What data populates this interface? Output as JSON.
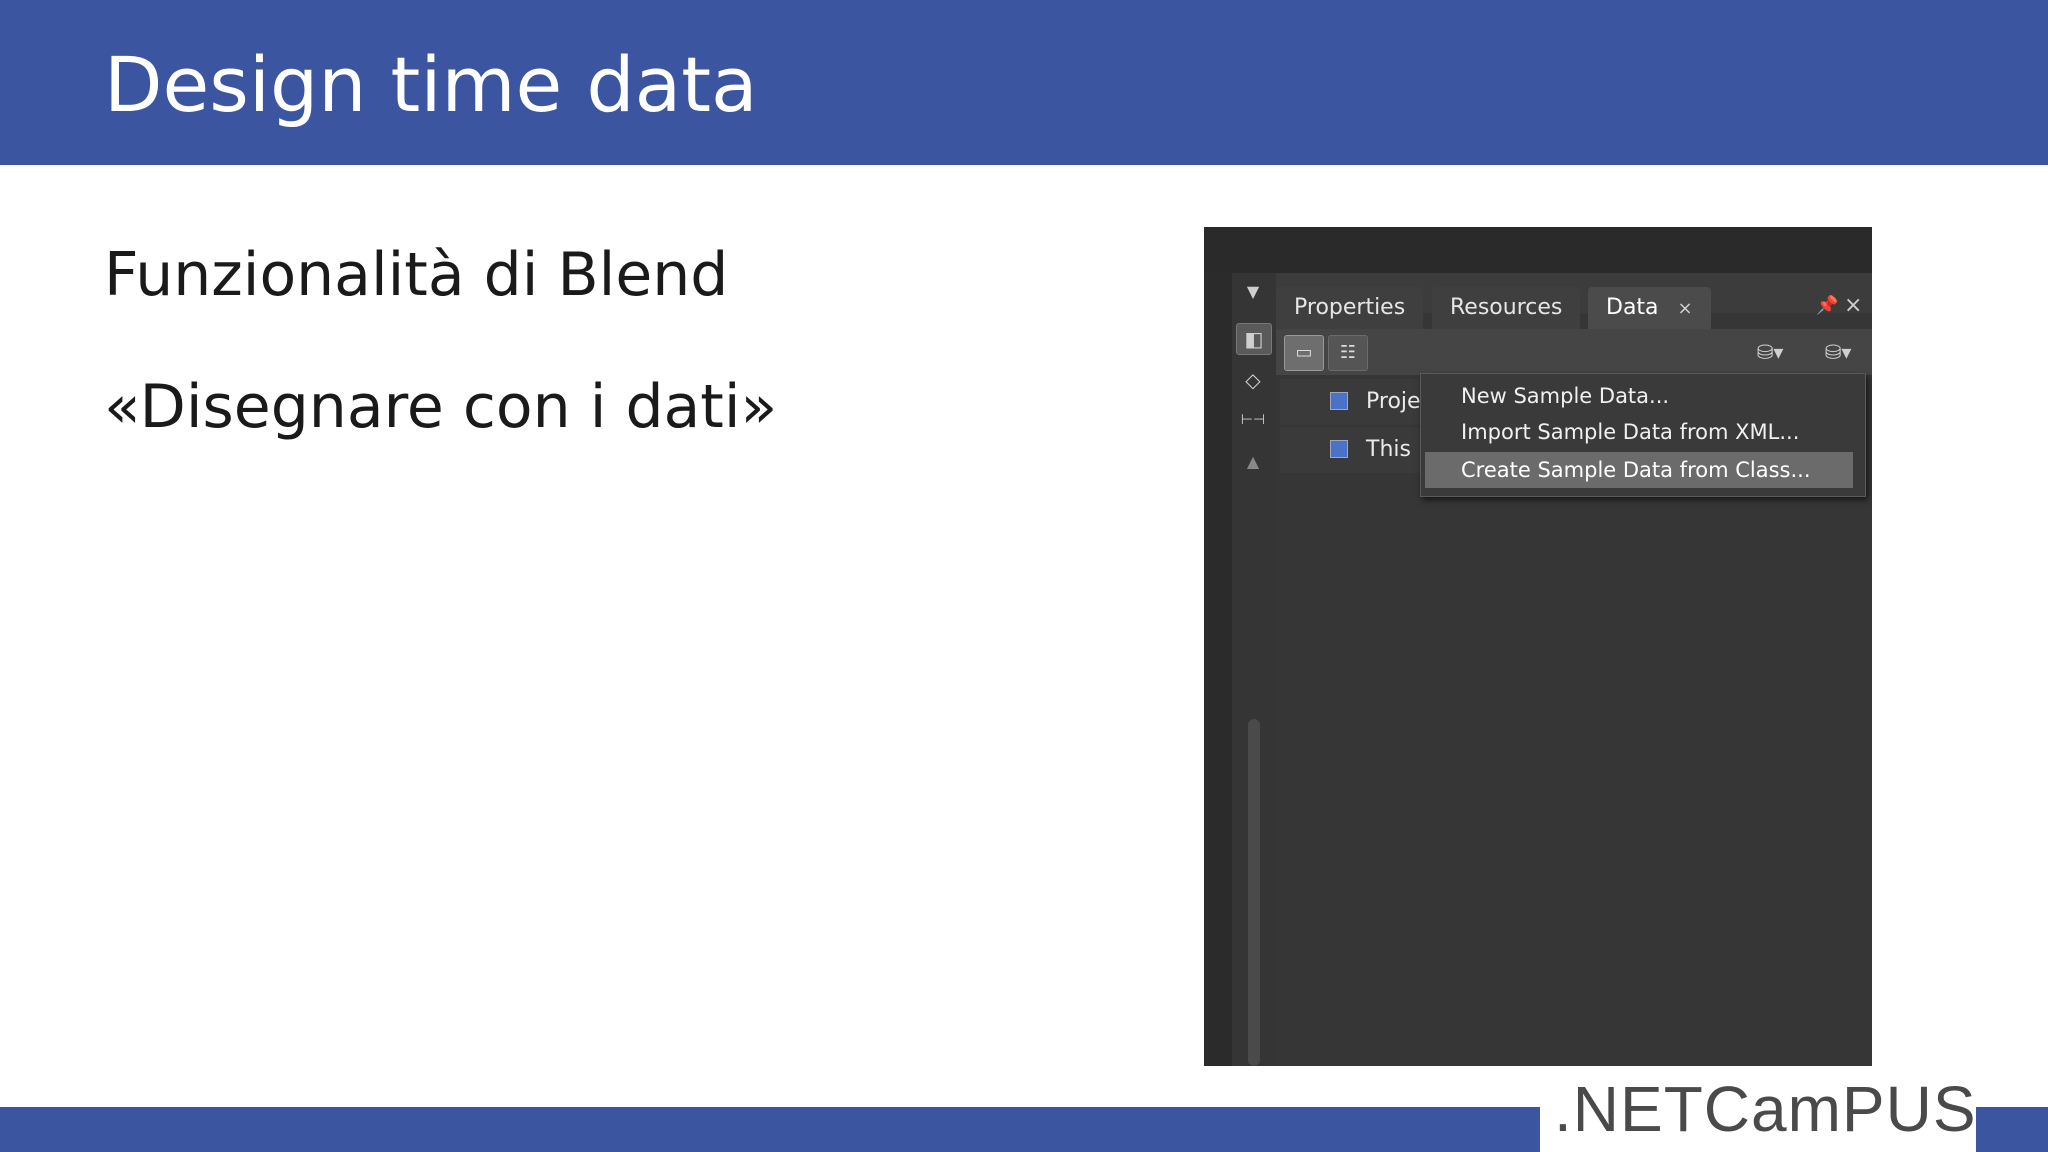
{
  "slide": {
    "title": "Design time data",
    "bullets": [
      "Funzionalità di Blend",
      "«Disegnare con i dati»"
    ],
    "logo": ".NETCamPUS",
    "accent_color": "#3c55a0"
  },
  "blend_panel": {
    "tabs": [
      {
        "label": "Properties"
      },
      {
        "label": "Resources"
      },
      {
        "label": "Data",
        "active": true,
        "close": "×"
      }
    ],
    "window_close": "×",
    "toolbar_icons": [
      "list-view-icon",
      "detail-view-icon",
      "add-datasource-icon",
      "add-sample-data-icon"
    ],
    "rail_icons": [
      "assets-icon",
      "code-icon",
      "layout-icon",
      "triangle-up-icon"
    ],
    "list_items": [
      {
        "label": "Proje"
      },
      {
        "label": "This"
      }
    ],
    "context_menu": [
      {
        "label": "New Sample Data..."
      },
      {
        "label": "Import Sample Data from XML..."
      },
      {
        "label": "Create Sample Data from Class...",
        "highlighted": true
      }
    ]
  }
}
